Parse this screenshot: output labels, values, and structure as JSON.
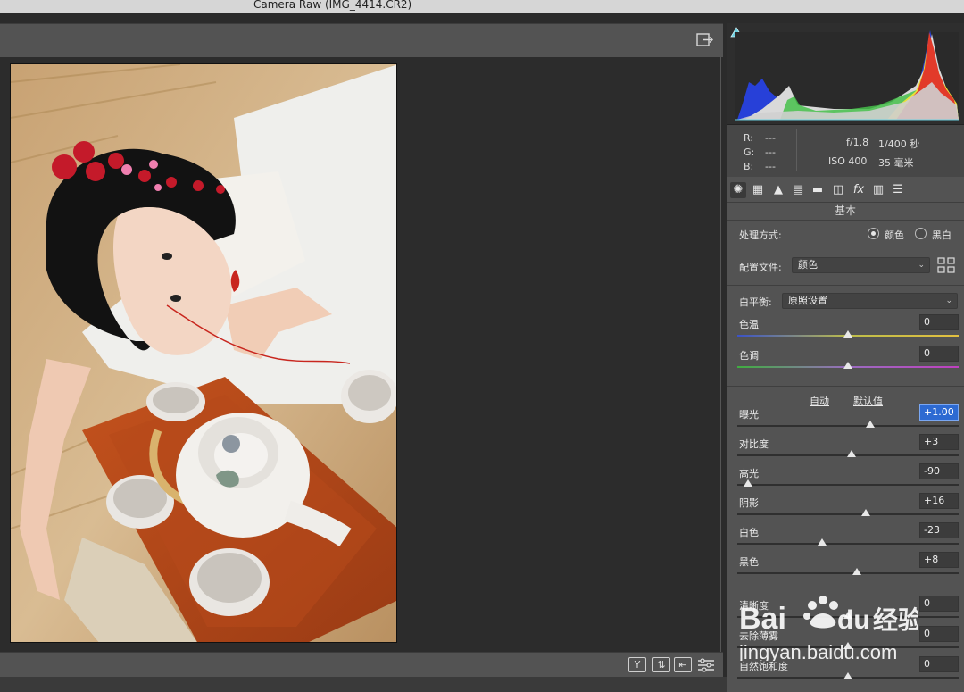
{
  "window": {
    "title": "Camera Raw (IMG_4414.CR2)"
  },
  "info": {
    "r_label": "R:",
    "r_value": "---",
    "g_label": "G:",
    "g_value": "---",
    "b_label": "B:",
    "b_value": "---",
    "aperture": "f/1.8",
    "shutter": "1/400 秒",
    "iso": "ISO 400",
    "focal": "35 毫米"
  },
  "panel": {
    "section_title": "基本",
    "treatment_label": "处理方式:",
    "treatment_color": "颜色",
    "treatment_bw": "黑白",
    "profile_label": "配置文件:",
    "profile_value": "颜色",
    "wb_label": "白平衡:",
    "wb_value": "原照设置",
    "auto_label": "自动",
    "default_label": "默认值"
  },
  "sliders": [
    {
      "label": "色温",
      "value": "0",
      "level": 0.5
    },
    {
      "label": "色调",
      "value": "0",
      "level": 0.5
    },
    {
      "label": "曝光",
      "value": "+1.00",
      "level": 0.6
    },
    {
      "label": "对比度",
      "value": "+3",
      "level": 0.515
    },
    {
      "label": "高光",
      "value": "-90",
      "level": 0.05
    },
    {
      "label": "阴影",
      "value": "+16",
      "level": 0.58
    },
    {
      "label": "白色",
      "value": "-23",
      "level": 0.385
    },
    {
      "label": "黑色",
      "value": "+8",
      "level": 0.54
    },
    {
      "label": "清晰度",
      "value": "0",
      "level": 0.5
    },
    {
      "label": "去除薄雾",
      "value": "0",
      "level": 0.5
    },
    {
      "label": "自然饱和度",
      "value": "0",
      "level": 0.5
    }
  ],
  "tool_icons": [
    "basic-aperture-icon",
    "tone-curve-icon",
    "detail-icon",
    "hsl-icon",
    "split-toning-icon",
    "lens-icon",
    "effects-fx-icon",
    "calibration-icon",
    "presets-icon"
  ],
  "watermark": {
    "brand": "Baidu经验",
    "url": "jingyan.baidu.com"
  },
  "colors": {
    "accent": "#2d6ad2",
    "panel": "#535353",
    "canvas": "#2c2c2c"
  }
}
